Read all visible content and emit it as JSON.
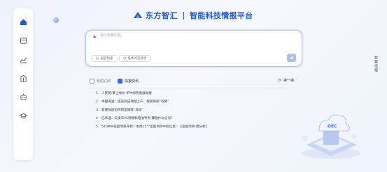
{
  "brand": {
    "name": "东方智汇",
    "slogan": "智能科技情报平台"
  },
  "sidebar": {
    "items": [
      {
        "icon": "home-icon"
      },
      {
        "icon": "database-icon"
      },
      {
        "icon": "chart-icon"
      },
      {
        "icon": "building-icon"
      },
      {
        "icon": "robot-icon"
      },
      {
        "icon": "graduation-cap-icon"
      }
    ]
  },
  "search": {
    "placeholder": "输入检索内容",
    "chip_1": "报告检索",
    "chip_2": "技术问答助手",
    "accent": "#3d6ef5"
  },
  "news": {
    "tab_subscribe": "我的订阅",
    "tab_hot": "情报快讯",
    "refresh": "换一换",
    "items": [
      "人民网:掌上绿州 护牛绿色发展动能",
      "中国海油：提前完成增储上产、能耗降碳“双降”",
      "新建加速迈向新型储能“高地”",
      "亿华通一天发布25项燃料电池专利 释放什么信号?",
      "510MW氢能项目开标！本周15个氢能项目中标信息！【氢能项目·周分析】"
    ]
  },
  "float_tab": "我要情报",
  "illustration": {
    "label": "DEC"
  }
}
